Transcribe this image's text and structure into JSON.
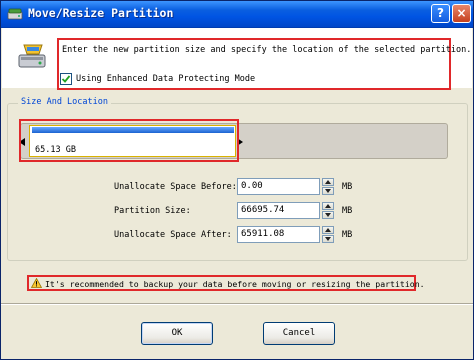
{
  "window": {
    "title": "Move/Resize Partition",
    "help_label": "?",
    "close_label": "×"
  },
  "header": {
    "instruction": "Enter the new partition size and specify the location of the selected partition.",
    "checkbox_label": "Using Enhanced Data Protecting Mode",
    "checkbox_checked": true
  },
  "group": {
    "label": "Size And Location"
  },
  "partition": {
    "size_label": "65.13 GB"
  },
  "fields": [
    {
      "label": "Unallocate Space Before:",
      "value": "0.00",
      "unit": "MB"
    },
    {
      "label": "Partition Size:",
      "value": "66695.74",
      "unit": "MB"
    },
    {
      "label": "Unallocate Space After:",
      "value": "65911.08",
      "unit": "MB"
    }
  ],
  "warning": {
    "text": "It's recommended to backup your data before moving or resizing the partition."
  },
  "buttons": {
    "ok_label": "OK",
    "cancel_label": "Cancel"
  },
  "colors": {
    "titlebar": "#0054e3",
    "highlight": "#e0282a",
    "group_label": "#0046d5",
    "partition_bar": "#1c63d1"
  }
}
